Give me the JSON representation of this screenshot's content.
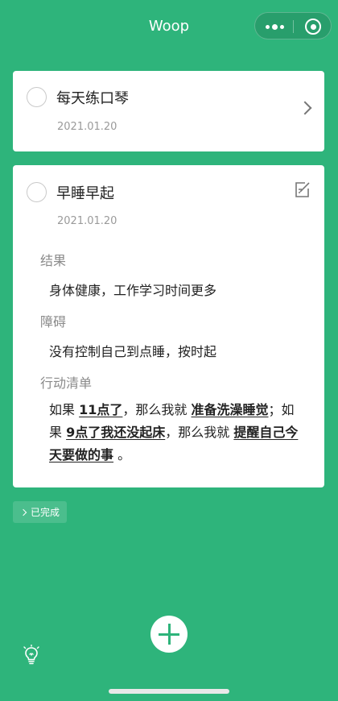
{
  "app": {
    "title": "Woop"
  },
  "colors": {
    "background": "#2eb47b",
    "card": "#ffffff"
  },
  "tasks": [
    {
      "title": "每天练口琴",
      "date": "2021.01.20",
      "expanded": false,
      "action_icon": "chevron-right-icon"
    },
    {
      "title": "早睡早起",
      "date": "2021.01.20",
      "expanded": true,
      "action_icon": "edit-icon",
      "result_label": "结果",
      "result_text": "身体健康，工作学习时间更多",
      "obstacle_label": "障碍",
      "obstacle_text": "没有控制自己到点睡，按时起",
      "plan_label": "行动清单",
      "plan": {
        "if_word": "如果",
        "condition_1": "11点了",
        "then_1": "，那么我就",
        "action_1": "准备洗澡睡觉",
        "separator": "；如果",
        "condition_2": "9点了我还没起床",
        "then_2": "，那么我就",
        "action_2": "提醒自己今天要做的事",
        "ending": "。"
      }
    }
  ],
  "completed_toggle": {
    "label": "已完成"
  },
  "fab": {
    "icon": "plus-icon"
  },
  "bottom_left": {
    "icon": "lightbulb-icon"
  }
}
